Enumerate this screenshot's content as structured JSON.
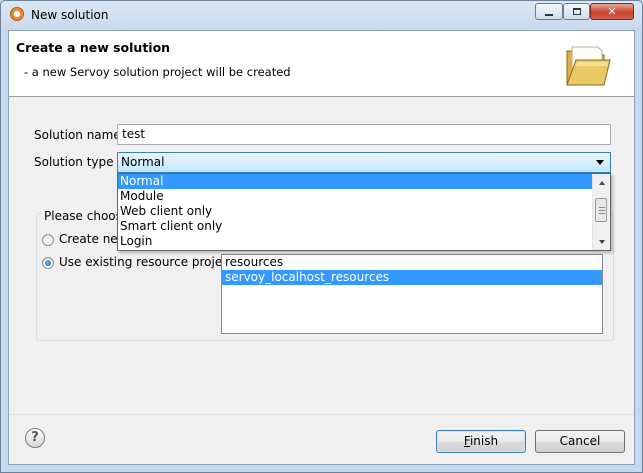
{
  "window": {
    "title": "New solution"
  },
  "header": {
    "title": "Create a new solution",
    "description": "- a new Servoy solution project will be created"
  },
  "form": {
    "solution_name_label": "Solution name",
    "solution_name_value": "test",
    "solution_type_label": "Solution type",
    "solution_type_value": "Normal",
    "solution_type_options": [
      "Normal",
      "Module",
      "Web client only",
      "Smart client only",
      "Login"
    ]
  },
  "resource_group": {
    "legend": "Please choose",
    "create_new_label": "Create new",
    "use_existing_label": "Use existing resource project",
    "selected_option": "Use existing resource project",
    "projects": [
      "resources",
      "servoy_localhost_resources"
    ],
    "selected_project": "servoy_localhost_resources"
  },
  "buttons": {
    "finish_first": "F",
    "finish_rest": "inish",
    "cancel": "Cancel",
    "help": "?"
  },
  "colors": {
    "selection": "#3399ff",
    "title_bar": "#c7d9ec",
    "close_button": "#c7452f"
  }
}
